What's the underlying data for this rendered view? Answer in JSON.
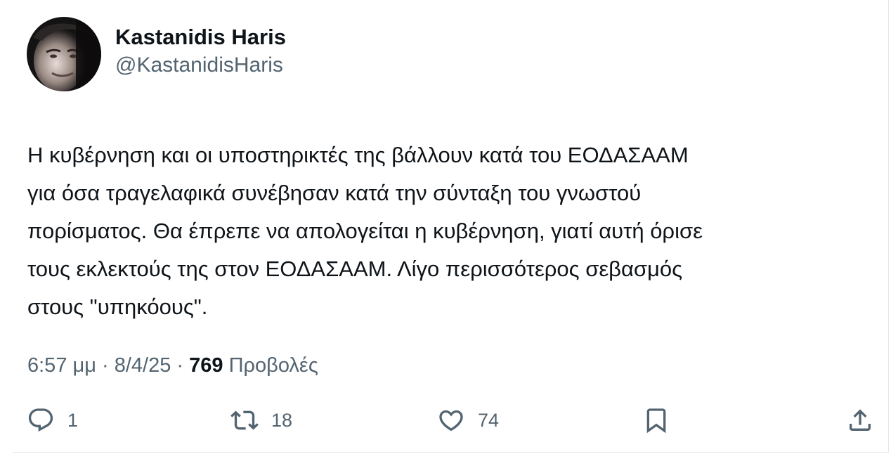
{
  "author": {
    "display_name": "Kastanidis Haris",
    "handle": "@KastanidisHaris"
  },
  "tweet": {
    "text": "Η κυβέρνηση και οι υποστηρικτές της βάλλουν κατά του ΕΟΔΑΣΑΑΜ\nγια όσα τραγελαφικά συνέβησαν κατά την σύνταξη του γνωστού\nπορίσματος. Θα έπρεπε να απολογείται η κυβέρνηση, γιατί αυτή όρισε\nτους εκλεκτούς της στον ΕΟΔΑΣΑΑΜ. Λίγο περισσότερος σεβασμός\nστους \"υπηκόους\"."
  },
  "meta": {
    "time": "6:57 μμ",
    "separator": "·",
    "date": "8/4/25",
    "views_count": "769",
    "views_label": "Προβολές"
  },
  "actions": {
    "reply": {
      "icon": "reply-icon",
      "count": "1"
    },
    "retweet": {
      "icon": "retweet-icon",
      "count": "18"
    },
    "like": {
      "icon": "heart-icon",
      "count": "74"
    },
    "bookmark": {
      "icon": "bookmark-icon"
    },
    "share": {
      "icon": "share-icon"
    }
  },
  "colors": {
    "text_primary": "#0f1419",
    "text_secondary": "#536471",
    "background": "#ffffff",
    "border": "#e6e6e6"
  }
}
